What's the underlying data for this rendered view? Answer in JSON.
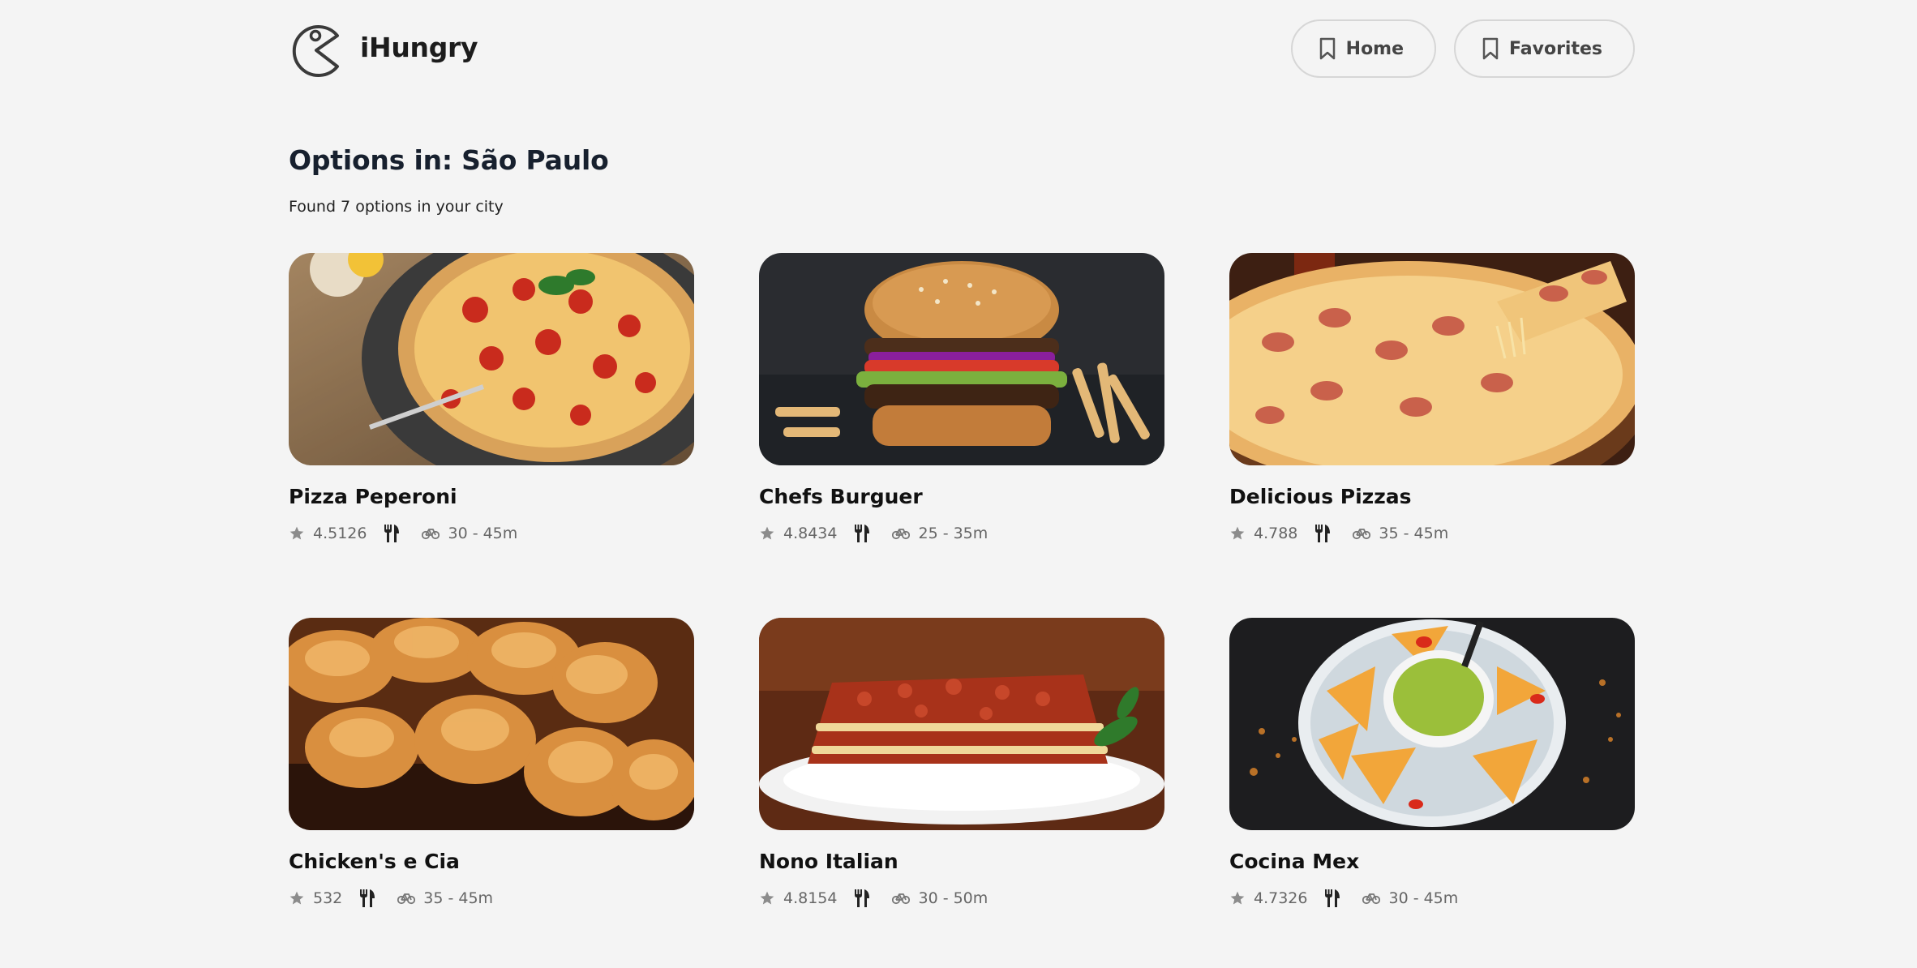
{
  "app": {
    "name": "iHungry"
  },
  "nav": {
    "home_label": "Home",
    "favorites_label": "Favorites"
  },
  "heading": {
    "title": "Options in: São Paulo",
    "subtitle": "Found 7 options in your city"
  },
  "restaurants": [
    {
      "name": "Pizza Peperoni",
      "rating": "4.5126",
      "delivery_time": "30 - 45m",
      "image": "pepperoni-pizza-photo"
    },
    {
      "name": "Chefs Burguer",
      "rating": "4.8434",
      "delivery_time": "25 - 35m",
      "image": "burger-photo"
    },
    {
      "name": "Delicious Pizzas",
      "rating": "4.788",
      "delivery_time": "35 - 45m",
      "image": "cheese-pull-pizza-photo"
    },
    {
      "name": "Chicken's e Cia",
      "rating": "532",
      "delivery_time": "35 - 45m",
      "image": "fried-chicken-photo"
    },
    {
      "name": "Nono Italian",
      "rating": "4.8154",
      "delivery_time": "30 - 50m",
      "image": "lasagna-photo"
    },
    {
      "name": "Cocina Mex",
      "rating": "4.7326",
      "delivery_time": "30 - 45m",
      "image": "nachos-guacamole-photo"
    }
  ],
  "icons": {
    "logo": "pacman-logo-icon",
    "nav": "bookmark-icon",
    "rating": "star-icon",
    "cuisine": "cutlery-icon",
    "delivery": "bicycle-icon"
  },
  "colors": {
    "background": "#f4f4f4",
    "title": "#17202e",
    "muted": "#666666",
    "border": "#d6d6d6"
  }
}
